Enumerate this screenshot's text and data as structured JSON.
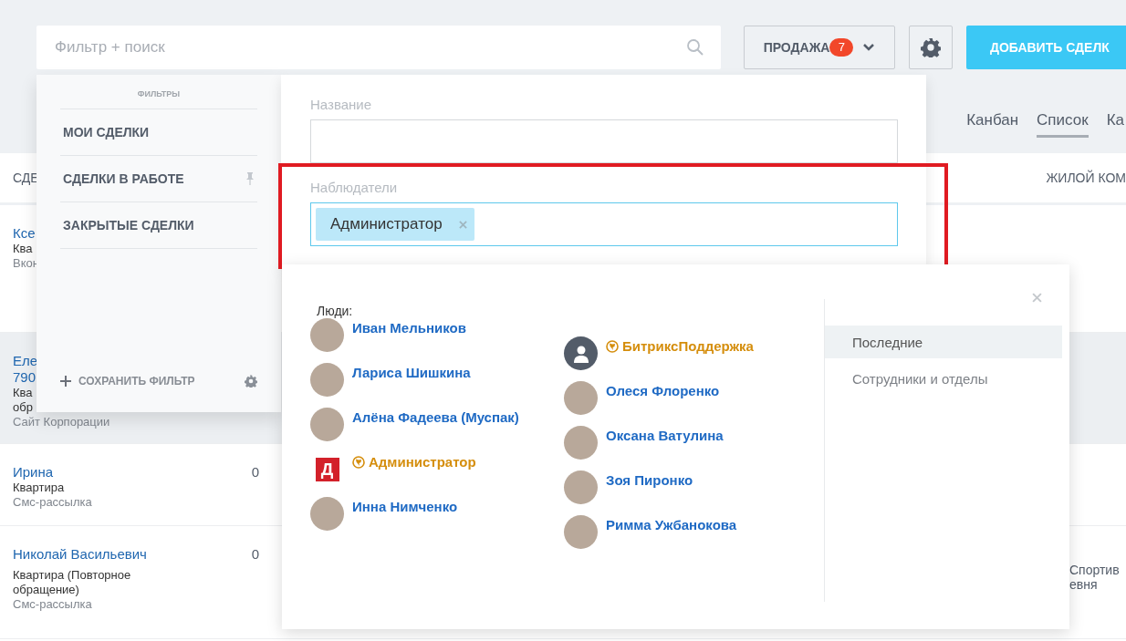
{
  "header": {
    "search": {
      "placeholder": "Фильтр + поиск"
    },
    "category_button": {
      "label": "ПРОДАЖА",
      "badge": "7"
    },
    "add_button": {
      "label": "ДОБАВИТЬ СДЕЛК"
    }
  },
  "view_tabs": [
    {
      "label": "Канбан",
      "selected": false
    },
    {
      "label": "Список",
      "selected": true
    },
    {
      "label": "Ка",
      "selected": false
    }
  ],
  "table": {
    "columns": [
      "СДЕ",
      "ЖИЛОЙ КОМ"
    ],
    "rows": [
      {
        "selected": false,
        "title": [
          "Ксе"
        ],
        "type": [
          "Ква"
        ],
        "source": "Вкон",
        "amount": "",
        "extra": []
      },
      {
        "selected": true,
        "title": [
          "Еле",
          "790"
        ],
        "type": [
          "Ква",
          "обр"
        ],
        "source": "Сайт Корпорации",
        "amount": "",
        "extra": []
      },
      {
        "selected": false,
        "title": [
          "Ирина"
        ],
        "type": [
          "Квартира"
        ],
        "source": "Смс-рассылка",
        "amount": "0",
        "extra": []
      },
      {
        "selected": false,
        "title": [
          "Николай Васильевич"
        ],
        "type": [
          "Квартира (Повторное обращение)"
        ],
        "source": "Смс-рассылка",
        "amount": "0",
        "extra": [
          "Спортив",
          "евня"
        ]
      }
    ]
  },
  "filter_popup": {
    "heading": "ФИЛЬТРЫ",
    "presets": [
      {
        "label": "МОИ СДЕЛКИ",
        "pinned": false
      },
      {
        "label": "СДЕЛКИ В РАБОТЕ",
        "pinned": true
      },
      {
        "label": "ЗАКРЫТЫЕ СДЕЛКИ",
        "pinned": false
      }
    ],
    "save_label": "СОХРАНИТЬ ФИЛЬТР",
    "fields": [
      {
        "label": "Название",
        "focused": false,
        "highlighted": false
      },
      {
        "label": "Наблюдатели",
        "tags": [
          "Администратор"
        ],
        "focused": true,
        "highlighted": true
      }
    ]
  },
  "people_popup": {
    "heading": "Люди:",
    "columns": [
      {
        "people": [
          {
            "name": "Иван Мельников",
            "external": false,
            "kind": "photo"
          },
          {
            "name": "Лариса Шишкина",
            "external": false,
            "kind": "photo"
          },
          {
            "name": "Алёна Фадеева (Муспак)",
            "external": false,
            "kind": "photo"
          },
          {
            "name": "Администратор",
            "external": true,
            "kind": "logo",
            "logo_text": "Д"
          },
          {
            "name": "Инна Нимченко",
            "external": false,
            "kind": "photo"
          }
        ]
      },
      {
        "people": [
          {
            "name": "БитриксПоддержка",
            "external": true,
            "kind": "silhouette"
          },
          {
            "name": "Олеся Флоренко",
            "external": false,
            "kind": "photo"
          },
          {
            "name": "Оксана Ватулина",
            "external": false,
            "kind": "photo"
          },
          {
            "name": "Зоя Пиронко",
            "external": false,
            "kind": "photo"
          },
          {
            "name": "Римма Ужбанокова",
            "external": false,
            "kind": "photo"
          }
        ]
      }
    ],
    "tabs": [
      {
        "label": "Последние",
        "selected": true
      },
      {
        "label": "Сотрудники и отделы",
        "selected": false
      }
    ]
  }
}
